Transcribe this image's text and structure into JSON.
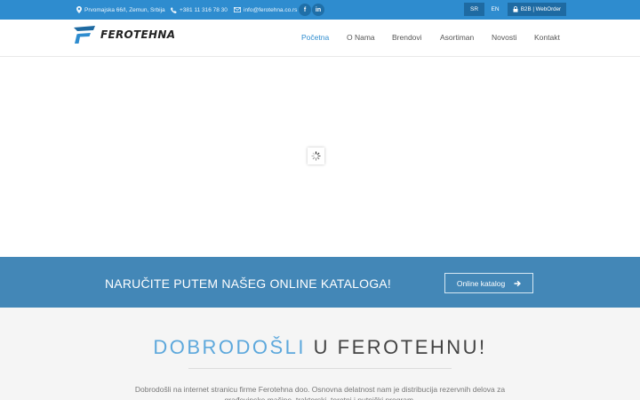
{
  "topbar": {
    "address": "Prvomajska 66/I, Zemun, Srbija",
    "phone": "+381 11 316 78 30",
    "email": "info@ferotehna.co.rs",
    "social": [
      {
        "icon": "facebook-icon",
        "glyph": "f"
      },
      {
        "icon": "linkedin-icon",
        "glyph": "in"
      }
    ],
    "languages": [
      "SR",
      "EN"
    ],
    "b2b_label": "B2B | WebOrder"
  },
  "header": {
    "logo_text": "FEROTEHNA",
    "nav": [
      {
        "label": "Početna",
        "active": true
      },
      {
        "label": "O Nama",
        "active": false
      },
      {
        "label": "Brendovi",
        "active": false
      },
      {
        "label": "Asortiman",
        "active": false
      },
      {
        "label": "Novosti",
        "active": false
      },
      {
        "label": "Kontakt",
        "active": false
      }
    ]
  },
  "cta": {
    "text": "NARUČITE PUTEM NAŠEG ONLINE KATALOGA!",
    "button_label": "Online katalog"
  },
  "welcome": {
    "title_part1": "DOBRODOŠLI",
    "title_part2": " U FEROTEHNU!",
    "text": "Dobrodošli na internet stranicu firme Ferotehna doo. Osnovna delatnost nam je distribucija rezervnih delova za građevinske mašine, traktorski, teretni i putnički program."
  },
  "colors": {
    "primary": "#2e8ccf",
    "cta_band": "#4387b7",
    "dark_blue": "#1e6aa2",
    "welcome_accent": "#5da8dc"
  }
}
